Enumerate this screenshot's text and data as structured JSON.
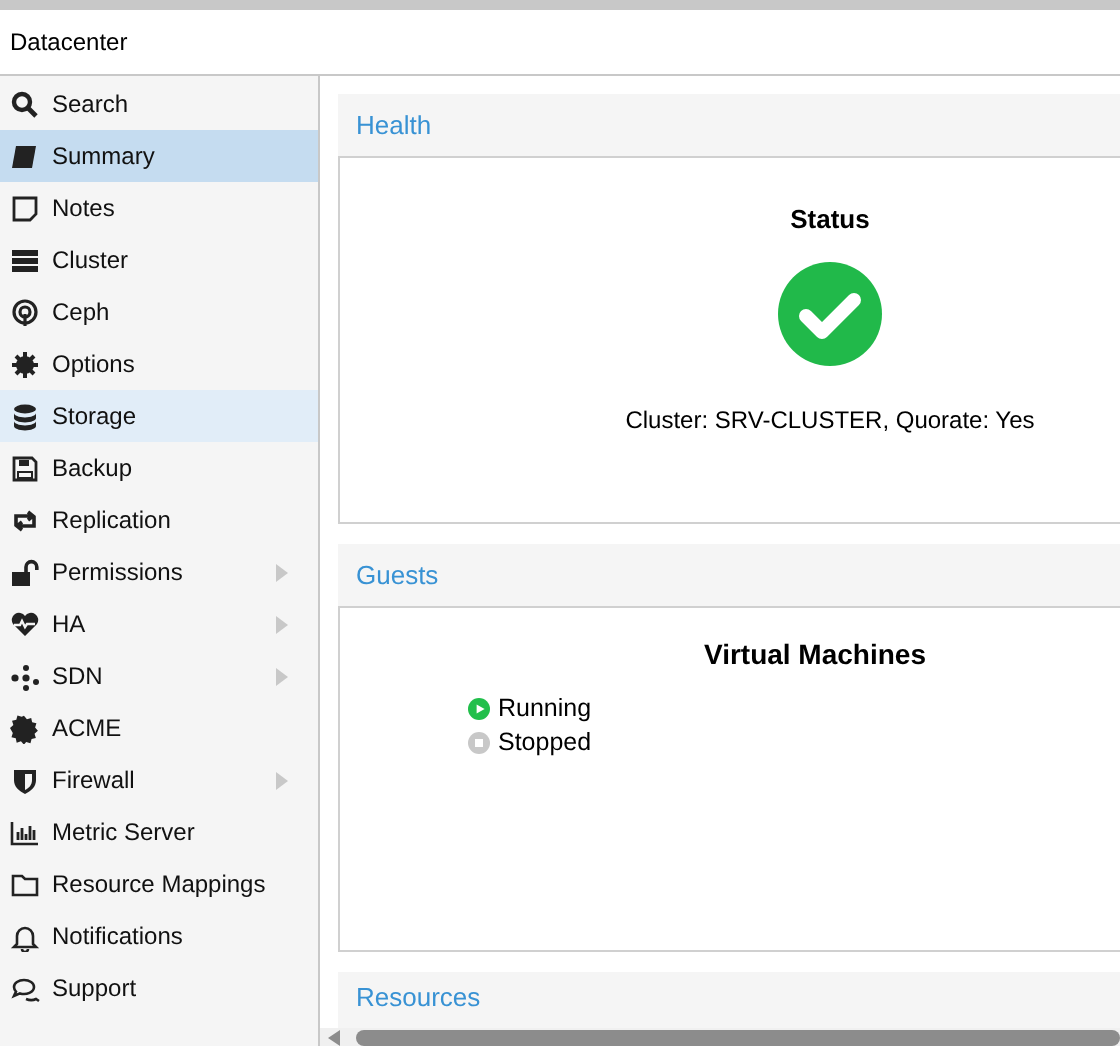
{
  "header": {
    "title": "Datacenter"
  },
  "sidebar": {
    "items": [
      {
        "label": "Search",
        "selected": false,
        "hovered": false,
        "has_submenu": false
      },
      {
        "label": "Summary",
        "selected": true,
        "hovered": false,
        "has_submenu": false
      },
      {
        "label": "Notes",
        "selected": false,
        "hovered": false,
        "has_submenu": false
      },
      {
        "label": "Cluster",
        "selected": false,
        "hovered": false,
        "has_submenu": false
      },
      {
        "label": "Ceph",
        "selected": false,
        "hovered": false,
        "has_submenu": false
      },
      {
        "label": "Options",
        "selected": false,
        "hovered": false,
        "has_submenu": false
      },
      {
        "label": "Storage",
        "selected": false,
        "hovered": true,
        "has_submenu": false
      },
      {
        "label": "Backup",
        "selected": false,
        "hovered": false,
        "has_submenu": false
      },
      {
        "label": "Replication",
        "selected": false,
        "hovered": false,
        "has_submenu": false
      },
      {
        "label": "Permissions",
        "selected": false,
        "hovered": false,
        "has_submenu": true
      },
      {
        "label": "HA",
        "selected": false,
        "hovered": false,
        "has_submenu": true
      },
      {
        "label": "SDN",
        "selected": false,
        "hovered": false,
        "has_submenu": true
      },
      {
        "label": "ACME",
        "selected": false,
        "hovered": false,
        "has_submenu": false
      },
      {
        "label": "Firewall",
        "selected": false,
        "hovered": false,
        "has_submenu": true
      },
      {
        "label": "Metric Server",
        "selected": false,
        "hovered": false,
        "has_submenu": false
      },
      {
        "label": "Resource Mappings",
        "selected": false,
        "hovered": false,
        "has_submenu": false
      },
      {
        "label": "Notifications",
        "selected": false,
        "hovered": false,
        "has_submenu": false
      },
      {
        "label": "Support",
        "selected": false,
        "hovered": false,
        "has_submenu": false
      }
    ]
  },
  "health": {
    "title": "Health",
    "status_title": "Status",
    "status_ok": true,
    "status_text": "Cluster: SRV-CLUSTER, Quorate: Yes"
  },
  "guests": {
    "title": "Guests",
    "vm_title": "Virtual Machines",
    "legend": [
      {
        "label": "Running",
        "color": "#21bf4b",
        "kind": "running"
      },
      {
        "label": "Stopped",
        "color": "#c8c8c8",
        "kind": "stopped"
      }
    ]
  },
  "resources": {
    "title": "Resources"
  }
}
